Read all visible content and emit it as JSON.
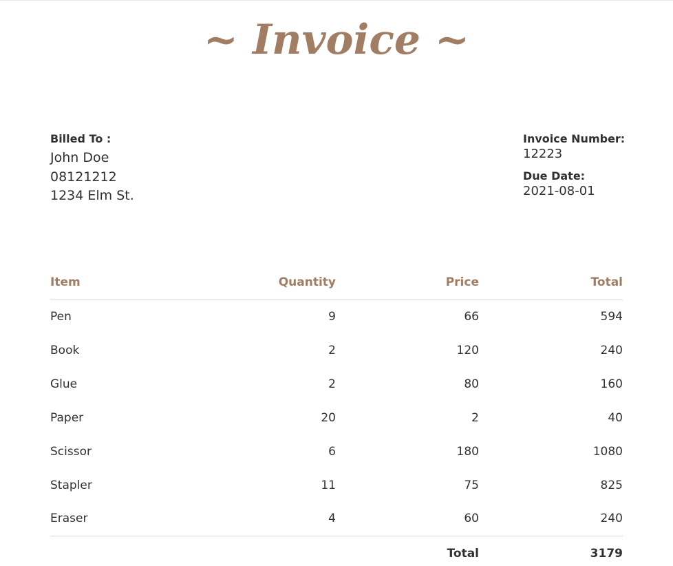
{
  "title": "~ Invoice ~",
  "billed_to": {
    "label": "Billed To :",
    "name": "John Doe",
    "phone": "08121212",
    "address": "1234 Elm St."
  },
  "invoice": {
    "number_label": "Invoice Number:",
    "number": "12223",
    "due_label": "Due Date:",
    "due": "2021-08-01"
  },
  "table": {
    "headers": [
      "Item",
      "Quantity",
      "Price",
      "Total"
    ],
    "rows": [
      [
        "Pen",
        "9",
        "66",
        "594"
      ],
      [
        "Book",
        "2",
        "120",
        "240"
      ],
      [
        "Glue",
        "2",
        "80",
        "160"
      ],
      [
        "Paper",
        "20",
        "2",
        "40"
      ],
      [
        "Scissor",
        "6",
        "180",
        "1080"
      ],
      [
        "Stapler",
        "11",
        "75",
        "825"
      ],
      [
        "Eraser",
        "4",
        "60",
        "240"
      ]
    ],
    "footer_label": "Total",
    "footer_value": "3179"
  },
  "colors": {
    "accent": "#a07d63",
    "text": "#2f3132",
    "rule": "#d6d6d6"
  }
}
